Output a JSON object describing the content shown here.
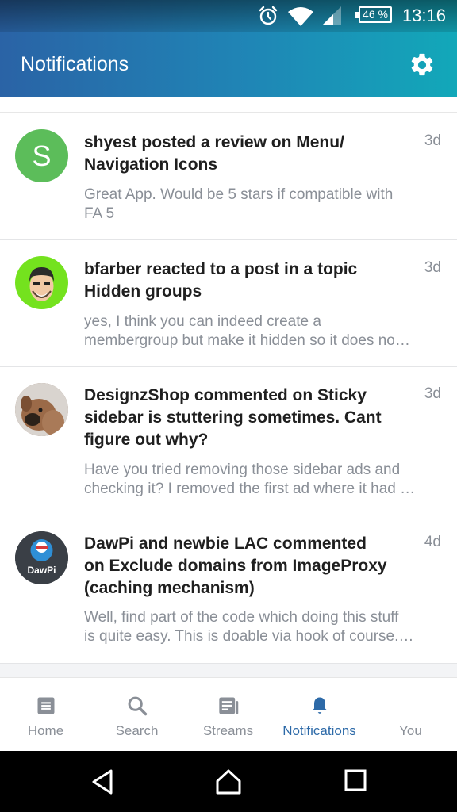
{
  "status_bar": {
    "battery": "46 %",
    "time": "13:16"
  },
  "app_bar": {
    "title": "Notifications",
    "settings_icon": "gear-icon"
  },
  "notifications": [
    {
      "avatar_letter": "S",
      "avatar_color": "#5cbd5a",
      "title_line1": "shyest posted a review on Menu/",
      "title_line2": "Navigation Icons",
      "title_line3": "",
      "body_line1": "Great App. Would be 5 stars if compatible with",
      "body_line2": "FA 5",
      "age": "3d"
    },
    {
      "avatar_letter": "",
      "avatar_color": "#74e21e",
      "title_line1": "bfarber reacted to a post in a topic",
      "title_line2": "Hidden groups",
      "title_line3": "",
      "body_line1": "yes, I think you can indeed create a",
      "body_line2": "membergroup but make it hidden so it does no…",
      "age": "3d"
    },
    {
      "avatar_letter": "",
      "avatar_color": "#b57c5a",
      "title_line1": "DesignzShop commented on Sticky",
      "title_line2": "sidebar is stuttering sometimes. Cant",
      "title_line3": "figure out why?",
      "body_line1": "Have you tried removing those sidebar ads and",
      "body_line2": "checking it? I removed the first ad where it had …",
      "age": "3d"
    },
    {
      "avatar_letter": "DawPi",
      "avatar_color": "#3a3f46",
      "title_line1": "DawPi and newbie LAC commented",
      "title_line2": "on Exclude domains from ImageProxy",
      "title_line3": "(caching mechanism)",
      "body_line1": "Well, find part of the code which doing this stuff",
      "body_line2": "is quite easy. This is doable via hook of course.…",
      "age": "4d"
    }
  ],
  "bottom_nav": [
    {
      "label": "Home",
      "icon": "home-icon"
    },
    {
      "label": "Search",
      "icon": "search-icon"
    },
    {
      "label": "Streams",
      "icon": "streams-icon"
    },
    {
      "label": "Notifications",
      "icon": "bell-icon"
    },
    {
      "label": "You",
      "icon": "user-icon"
    }
  ],
  "colors": {
    "accent": "#2d6aa8",
    "muted": "#8a8f97",
    "header_gradient_start": "#2a63a6",
    "header_gradient_end": "#12a8b9"
  }
}
